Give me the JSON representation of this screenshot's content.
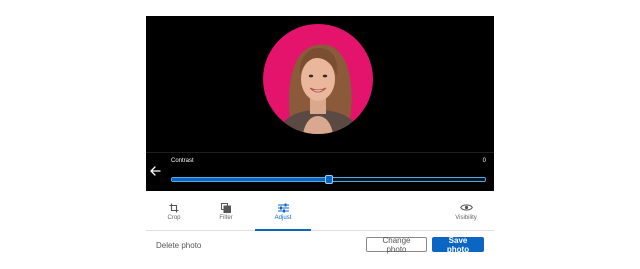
{
  "editor": {
    "slider": {
      "label": "Contrast",
      "value_text": "0",
      "position_fraction": 0.5
    },
    "colors": {
      "background": "#000000",
      "frame": "#e4136b",
      "accent": "#0a66c2"
    }
  },
  "tabs": [
    {
      "label": "Crop",
      "icon": "crop-icon",
      "active": false
    },
    {
      "label": "Filter",
      "icon": "filter-icon",
      "active": false
    },
    {
      "label": "Adjust",
      "icon": "adjust-icon",
      "active": true
    },
    {
      "label": "Visibility",
      "icon": "eye-icon",
      "active": false
    }
  ],
  "footer": {
    "delete_label": "Delete photo",
    "change_label": "Change photo",
    "save_label": "Save photo"
  }
}
